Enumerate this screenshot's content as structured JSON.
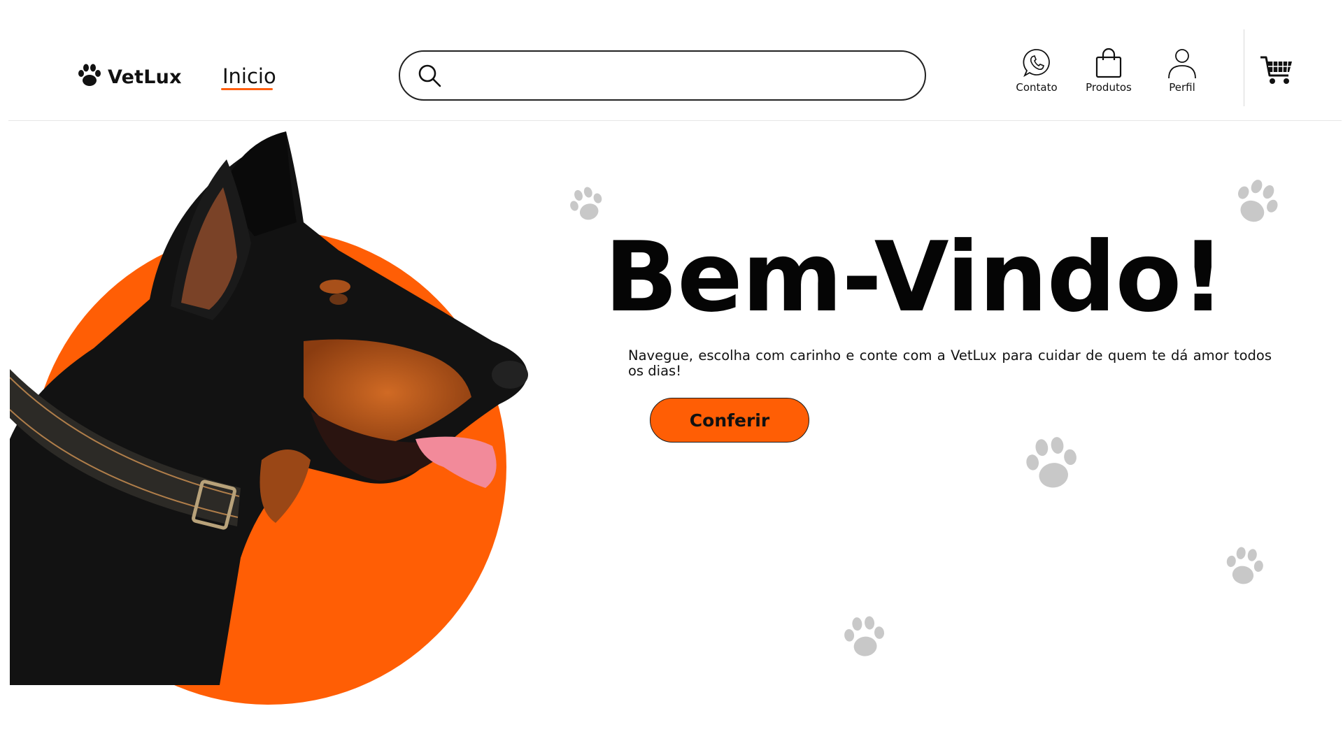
{
  "header": {
    "logo_text": "VetLux",
    "nav": [
      {
        "label": "Inicio",
        "active": true
      }
    ],
    "search": {
      "placeholder": "",
      "value": ""
    },
    "actions": [
      {
        "label": "Contato",
        "icon": "phone-icon"
      },
      {
        "label": "Produtos",
        "icon": "shopping-bag-icon"
      },
      {
        "label": "Perfil",
        "icon": "user-icon"
      }
    ],
    "cart_icon": "shopping-cart-icon"
  },
  "hero": {
    "title": "Bem-Vindo!",
    "subtitle": "Navegue, escolha com carinho e conte com a VetLux para cuidar de quem te dá amor todos os dias!",
    "cta_label": "Conferir",
    "image": "doberman-dog-profile",
    "decor_icon": "paw-print-icon"
  },
  "colors": {
    "accent": "#ff5e05",
    "text": "#111111",
    "paw_decor": "#c8c8c8",
    "background": "#ffffff"
  }
}
